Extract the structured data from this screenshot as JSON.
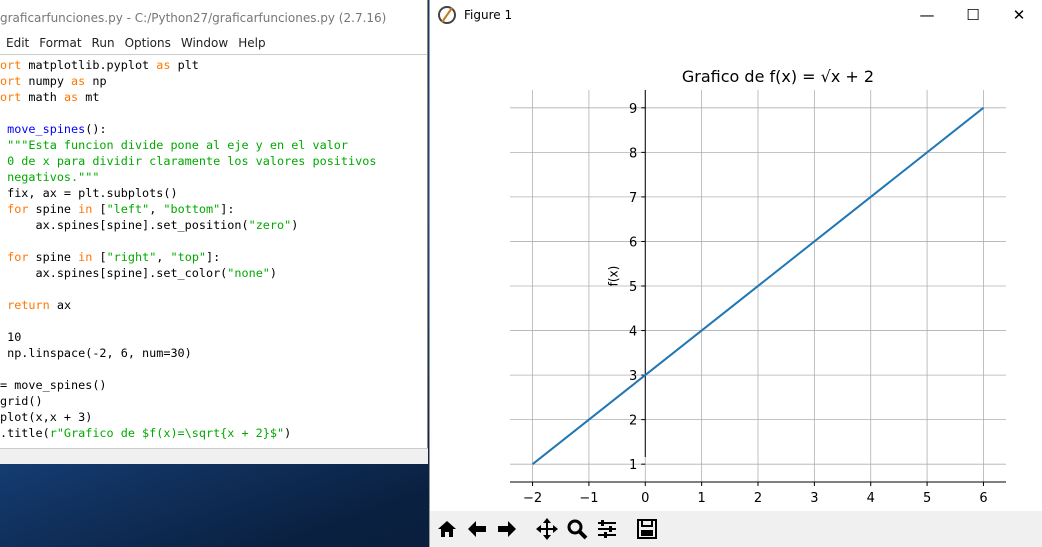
{
  "editor": {
    "title": "graficarfunciones.py - C:/Python27/graficarfunciones.py (2.7.16)",
    "menu": [
      "Edit",
      "Format",
      "Run",
      "Options",
      "Window",
      "Help"
    ],
    "code": [
      {
        "parts": [
          [
            "ort",
            "kw"
          ],
          [
            " matplotlib.pyplot ",
            ""
          ],
          [
            "as",
            "kw"
          ],
          [
            " plt",
            ""
          ]
        ]
      },
      {
        "parts": [
          [
            "ort",
            "kw"
          ],
          [
            " numpy ",
            ""
          ],
          [
            "as",
            "kw"
          ],
          [
            " np",
            ""
          ]
        ]
      },
      {
        "parts": [
          [
            "ort",
            "kw"
          ],
          [
            " math ",
            ""
          ],
          [
            "as",
            "kw"
          ],
          [
            " mt",
            ""
          ]
        ]
      },
      {
        "parts": [
          [
            "",
            ""
          ]
        ]
      },
      {
        "parts": [
          [
            " ",
            ""
          ],
          [
            "move_spines",
            "fn"
          ],
          [
            "():",
            ""
          ]
        ]
      },
      {
        "parts": [
          [
            " \"\"\"Esta funcion divide pone al eje y en el valor",
            "str"
          ]
        ]
      },
      {
        "parts": [
          [
            " 0 de x para dividir claramente los valores positivos",
            "str"
          ]
        ]
      },
      {
        "parts": [
          [
            " negativos.\"\"\"",
            "str"
          ]
        ]
      },
      {
        "parts": [
          [
            " fix, ax = plt.subplots()",
            ""
          ]
        ]
      },
      {
        "parts": [
          [
            " ",
            ""
          ],
          [
            "for",
            "kw"
          ],
          [
            " spine ",
            ""
          ],
          [
            "in",
            "kw"
          ],
          [
            " [",
            ""
          ],
          [
            "\"left\"",
            "str"
          ],
          [
            ", ",
            ""
          ],
          [
            "\"bottom\"",
            "str"
          ],
          [
            "]:",
            ""
          ]
        ]
      },
      {
        "parts": [
          [
            "     ax.spines[spine].set_position(",
            ""
          ],
          [
            "\"zero\"",
            "str"
          ],
          [
            ")",
            ""
          ]
        ]
      },
      {
        "parts": [
          [
            "",
            ""
          ]
        ]
      },
      {
        "parts": [
          [
            " ",
            ""
          ],
          [
            "for",
            "kw"
          ],
          [
            " spine ",
            ""
          ],
          [
            "in",
            "kw"
          ],
          [
            " [",
            ""
          ],
          [
            "\"right\"",
            "str"
          ],
          [
            ", ",
            ""
          ],
          [
            "\"top\"",
            "str"
          ],
          [
            "]:",
            ""
          ]
        ]
      },
      {
        "parts": [
          [
            "     ax.spines[spine].set_color(",
            ""
          ],
          [
            "\"none\"",
            "str"
          ],
          [
            ")",
            ""
          ]
        ]
      },
      {
        "parts": [
          [
            "",
            ""
          ]
        ]
      },
      {
        "parts": [
          [
            " ",
            ""
          ],
          [
            "return",
            "kw"
          ],
          [
            " ax",
            ""
          ]
        ]
      },
      {
        "parts": [
          [
            "",
            ""
          ]
        ]
      },
      {
        "parts": [
          [
            " 10",
            ""
          ]
        ]
      },
      {
        "parts": [
          [
            " np.linspace(-2, 6, num=30)",
            ""
          ]
        ]
      },
      {
        "parts": [
          [
            "",
            ""
          ]
        ]
      },
      {
        "parts": [
          [
            "= move_spines()",
            ""
          ]
        ]
      },
      {
        "parts": [
          [
            "grid()",
            ""
          ]
        ]
      },
      {
        "parts": [
          [
            "plot(x,x + 3)",
            ""
          ]
        ]
      },
      {
        "parts": [
          [
            ".title(",
            ""
          ],
          [
            "r\"Grafico de $f(x)=\\sqrt{x + 2}$\"",
            "str"
          ],
          [
            ")",
            ""
          ]
        ]
      }
    ]
  },
  "figure": {
    "window_title": "Figure 1",
    "controls": [
      "—",
      "☐",
      "✕"
    ],
    "toolbar": [
      "home-icon",
      "back-icon",
      "forward-icon",
      "pan-icon",
      "zoom-icon",
      "configure-icon",
      "save-icon"
    ]
  },
  "colors": {
    "line": "#1f77b4",
    "keyword": "#ff7700",
    "string": "#00aa00",
    "function": "#0000ff"
  },
  "chart_data": {
    "type": "line",
    "title": "Grafico de f(x) = √x + 2",
    "ylabel": "f(x)",
    "xlabel": "",
    "x": [
      -2,
      6
    ],
    "y": [
      1,
      9
    ],
    "xlim": [
      -2.4,
      6.4
    ],
    "ylim": [
      0.6,
      9.4
    ],
    "xticks": [
      -2,
      -1,
      0,
      1,
      2,
      3,
      4,
      5,
      6
    ],
    "yticks": [
      1,
      2,
      3,
      4,
      5,
      6,
      7,
      8,
      9
    ],
    "xtick_labels": [
      "−2",
      "−1",
      "0",
      "1",
      "2",
      "3",
      "4",
      "5",
      "6"
    ],
    "ytick_labels": [
      "1",
      "2",
      "3",
      "4",
      "5",
      "6",
      "7",
      "8",
      "9"
    ],
    "grid": true,
    "series": [
      {
        "x": [
          -2,
          6
        ],
        "y": [
          1,
          9
        ]
      }
    ]
  }
}
